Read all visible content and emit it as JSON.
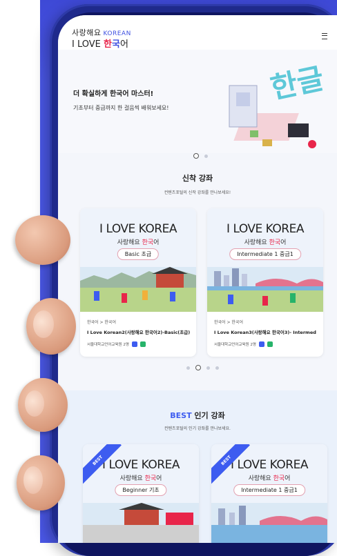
{
  "app": {
    "logo_top": "사랑해요",
    "logo_top_en": "KOREAN",
    "logo_bottom_en": "I LOVE",
    "logo_bottom_kr1": "한",
    "logo_bottom_kr2": "국",
    "logo_bottom_kr3": "어"
  },
  "hero": {
    "title": "더 확실하게 한국어 마스터!",
    "subtitle": "기초부터 중급까지 한 걸음씩 배워보세요!",
    "art_text": "한글",
    "slides": 2,
    "active_slide": 0
  },
  "new_courses": {
    "title": "신착 강좌",
    "subtitle": "컨텐츠포털의 신작 강좌를 만나보세요!",
    "cards": [
      {
        "thumb_title": "I LOVE KOREA",
        "thumb_sub_a": "사랑해요",
        "thumb_sub_kr": "한국",
        "thumb_sub_b": "어",
        "level": "Basic 초급",
        "category": "한국어 > 한국어",
        "title": "I Love Korean2(사랑해요 한국어2)-Basic(초급)",
        "instructor": "서울대학교언어교육원 2명"
      },
      {
        "thumb_title": "I LOVE KOREA",
        "thumb_sub_a": "사랑해요",
        "thumb_sub_kr": "한국",
        "thumb_sub_b": "어",
        "level": "Intermediate 1 중급1",
        "category": "한국어 > 한국어",
        "title": "I Love Korean3(사랑해요 한국어3)- Intermed",
        "instructor": "서울대학교언어교육원 2명"
      }
    ],
    "pages": 4,
    "active_page": 1
  },
  "best_courses": {
    "title_best": "BEST",
    "title_rest": "인기 강좌",
    "subtitle": "컨텐츠포털의 인기 강좌를 만나보세요.",
    "cards": [
      {
        "ribbon": "BEST",
        "thumb_title": "I LOVE KOREA",
        "thumb_sub_a": "사랑해요",
        "thumb_sub_kr": "한국",
        "thumb_sub_b": "어",
        "level": "Beginner 기초"
      },
      {
        "ribbon": "BEST",
        "thumb_title": "I LOVE KOREA",
        "thumb_sub_a": "사랑해요",
        "thumb_sub_kr": "한국",
        "thumb_sub_b": "어",
        "level": "Intermediate 1 중급1"
      }
    ]
  },
  "colors": {
    "background_panel": "#4a57e6",
    "phone_frame": "#1f2a8c",
    "accent_blue": "#3d5cf0",
    "accent_red": "#e8254a"
  }
}
